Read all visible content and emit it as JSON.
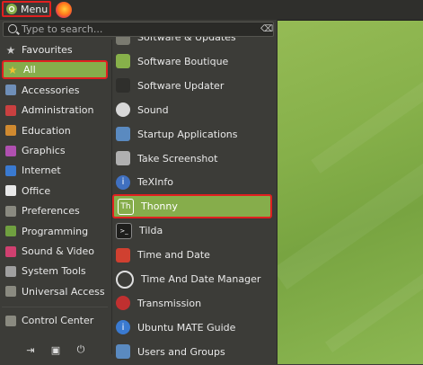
{
  "panel": {
    "menu_label": "Menu",
    "launchers": [
      {
        "icon": "firefox-icon"
      }
    ]
  },
  "search": {
    "placeholder": "Type to search..."
  },
  "categories": [
    {
      "label": "Favourites",
      "icon": "star-icon",
      "color": "#c9c9c9"
    },
    {
      "label": "All",
      "icon": "star-icon",
      "color": "#f0c030",
      "selected": true
    },
    {
      "label": "Accessories",
      "icon": "accessories-icon",
      "color": "#6f8fb8"
    },
    {
      "label": "Administration",
      "icon": "administration-icon",
      "color": "#c94040"
    },
    {
      "label": "Education",
      "icon": "education-icon",
      "color": "#d08a30"
    },
    {
      "label": "Graphics",
      "icon": "graphics-icon",
      "color": "#b050b0"
    },
    {
      "label": "Internet",
      "icon": "internet-icon",
      "color": "#3a7ad0"
    },
    {
      "label": "Office",
      "icon": "office-icon",
      "color": "#e8e8e8"
    },
    {
      "label": "Preferences",
      "icon": "preferences-icon",
      "color": "#8a8a80"
    },
    {
      "label": "Programming",
      "icon": "programming-icon",
      "color": "#70a040"
    },
    {
      "label": "Sound & Video",
      "icon": "sound-video-icon",
      "color": "#d04070"
    },
    {
      "label": "System Tools",
      "icon": "system-tools-icon",
      "color": "#a0a0a0"
    },
    {
      "label": "Universal Access",
      "icon": "universal-access-icon",
      "color": "#8a8a80"
    },
    {
      "label": "Control Center",
      "icon": "control-center-icon",
      "color": "#8a8a80"
    }
  ],
  "apps": [
    {
      "label": "Software & Updates",
      "icon": "software-updates-icon",
      "color": "#7a7a70"
    },
    {
      "label": "Software Boutique",
      "icon": "software-boutique-icon",
      "color": "#87b04a"
    },
    {
      "label": "Software Updater",
      "icon": "software-updater-icon",
      "color": "#2f2f2c"
    },
    {
      "label": "Sound",
      "icon": "sound-icon",
      "color": "#d8d8d8"
    },
    {
      "label": "Startup Applications",
      "icon": "startup-applications-icon",
      "color": "#5a8ac0"
    },
    {
      "label": "Take Screenshot",
      "icon": "camera-icon",
      "color": "#b0b0b0"
    },
    {
      "label": "TeXInfo",
      "icon": "info-icon",
      "color": "#4070c0"
    },
    {
      "label": "Thonny",
      "icon": "thonny-icon",
      "color": "#86ad4b",
      "highlighted": true
    },
    {
      "label": "Tilda",
      "icon": "terminal-icon",
      "color": "#1e1e1c"
    },
    {
      "label": "Time and Date",
      "icon": "calendar-icon",
      "color": "#d04030"
    },
    {
      "label": "Time And Date Manager",
      "icon": "clock-icon",
      "color": "#e0e0e0"
    },
    {
      "label": "Transmission",
      "icon": "transmission-icon",
      "color": "#c03030"
    },
    {
      "label": "Ubuntu MATE Guide",
      "icon": "info-icon",
      "color": "#3a7ad0"
    },
    {
      "label": "Users and Groups",
      "icon": "users-icon",
      "color": "#5a8ac0"
    }
  ],
  "bottom_buttons": [
    {
      "name": "logout-icon",
      "glyph": "⇥"
    },
    {
      "name": "lock-screen-icon",
      "glyph": "▣"
    },
    {
      "name": "power-icon",
      "glyph": "⏻"
    }
  ]
}
